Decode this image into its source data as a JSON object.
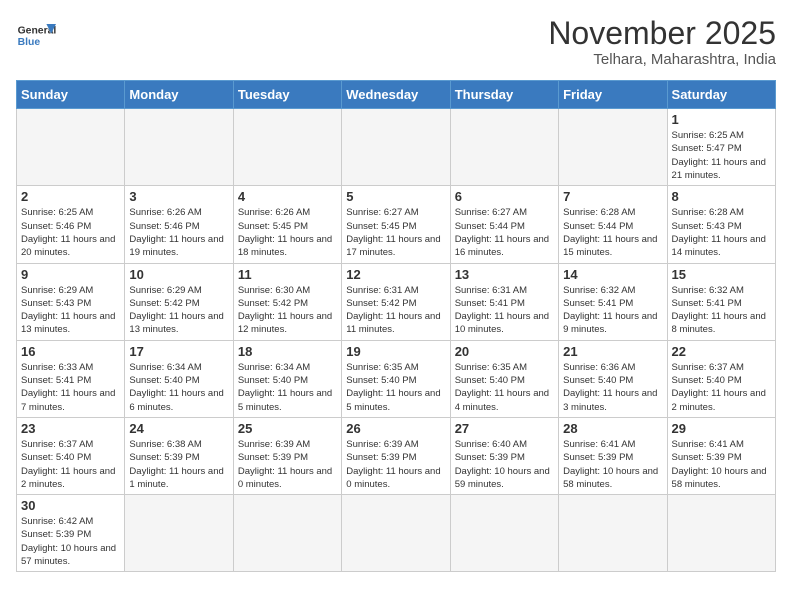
{
  "logo": {
    "text_general": "General",
    "text_blue": "Blue"
  },
  "title": {
    "month_year": "November 2025",
    "location": "Telhara, Maharashtra, India"
  },
  "weekdays": [
    "Sunday",
    "Monday",
    "Tuesday",
    "Wednesday",
    "Thursday",
    "Friday",
    "Saturday"
  ],
  "days": [
    {
      "day": "",
      "info": ""
    },
    {
      "day": "",
      "info": ""
    },
    {
      "day": "",
      "info": ""
    },
    {
      "day": "",
      "info": ""
    },
    {
      "day": "",
      "info": ""
    },
    {
      "day": "",
      "info": ""
    },
    {
      "day": "1",
      "info": "Sunrise: 6:25 AM\nSunset: 5:47 PM\nDaylight: 11 hours and 21 minutes."
    },
    {
      "day": "2",
      "info": "Sunrise: 6:25 AM\nSunset: 5:46 PM\nDaylight: 11 hours and 20 minutes."
    },
    {
      "day": "3",
      "info": "Sunrise: 6:26 AM\nSunset: 5:46 PM\nDaylight: 11 hours and 19 minutes."
    },
    {
      "day": "4",
      "info": "Sunrise: 6:26 AM\nSunset: 5:45 PM\nDaylight: 11 hours and 18 minutes."
    },
    {
      "day": "5",
      "info": "Sunrise: 6:27 AM\nSunset: 5:45 PM\nDaylight: 11 hours and 17 minutes."
    },
    {
      "day": "6",
      "info": "Sunrise: 6:27 AM\nSunset: 5:44 PM\nDaylight: 11 hours and 16 minutes."
    },
    {
      "day": "7",
      "info": "Sunrise: 6:28 AM\nSunset: 5:44 PM\nDaylight: 11 hours and 15 minutes."
    },
    {
      "day": "8",
      "info": "Sunrise: 6:28 AM\nSunset: 5:43 PM\nDaylight: 11 hours and 14 minutes."
    },
    {
      "day": "9",
      "info": "Sunrise: 6:29 AM\nSunset: 5:43 PM\nDaylight: 11 hours and 13 minutes."
    },
    {
      "day": "10",
      "info": "Sunrise: 6:29 AM\nSunset: 5:42 PM\nDaylight: 11 hours and 13 minutes."
    },
    {
      "day": "11",
      "info": "Sunrise: 6:30 AM\nSunset: 5:42 PM\nDaylight: 11 hours and 12 minutes."
    },
    {
      "day": "12",
      "info": "Sunrise: 6:31 AM\nSunset: 5:42 PM\nDaylight: 11 hours and 11 minutes."
    },
    {
      "day": "13",
      "info": "Sunrise: 6:31 AM\nSunset: 5:41 PM\nDaylight: 11 hours and 10 minutes."
    },
    {
      "day": "14",
      "info": "Sunrise: 6:32 AM\nSunset: 5:41 PM\nDaylight: 11 hours and 9 minutes."
    },
    {
      "day": "15",
      "info": "Sunrise: 6:32 AM\nSunset: 5:41 PM\nDaylight: 11 hours and 8 minutes."
    },
    {
      "day": "16",
      "info": "Sunrise: 6:33 AM\nSunset: 5:41 PM\nDaylight: 11 hours and 7 minutes."
    },
    {
      "day": "17",
      "info": "Sunrise: 6:34 AM\nSunset: 5:40 PM\nDaylight: 11 hours and 6 minutes."
    },
    {
      "day": "18",
      "info": "Sunrise: 6:34 AM\nSunset: 5:40 PM\nDaylight: 11 hours and 5 minutes."
    },
    {
      "day": "19",
      "info": "Sunrise: 6:35 AM\nSunset: 5:40 PM\nDaylight: 11 hours and 5 minutes."
    },
    {
      "day": "20",
      "info": "Sunrise: 6:35 AM\nSunset: 5:40 PM\nDaylight: 11 hours and 4 minutes."
    },
    {
      "day": "21",
      "info": "Sunrise: 6:36 AM\nSunset: 5:40 PM\nDaylight: 11 hours and 3 minutes."
    },
    {
      "day": "22",
      "info": "Sunrise: 6:37 AM\nSunset: 5:40 PM\nDaylight: 11 hours and 2 minutes."
    },
    {
      "day": "23",
      "info": "Sunrise: 6:37 AM\nSunset: 5:40 PM\nDaylight: 11 hours and 2 minutes."
    },
    {
      "day": "24",
      "info": "Sunrise: 6:38 AM\nSunset: 5:39 PM\nDaylight: 11 hours and 1 minute."
    },
    {
      "day": "25",
      "info": "Sunrise: 6:39 AM\nSunset: 5:39 PM\nDaylight: 11 hours and 0 minutes."
    },
    {
      "day": "26",
      "info": "Sunrise: 6:39 AM\nSunset: 5:39 PM\nDaylight: 11 hours and 0 minutes."
    },
    {
      "day": "27",
      "info": "Sunrise: 6:40 AM\nSunset: 5:39 PM\nDaylight: 10 hours and 59 minutes."
    },
    {
      "day": "28",
      "info": "Sunrise: 6:41 AM\nSunset: 5:39 PM\nDaylight: 10 hours and 58 minutes."
    },
    {
      "day": "29",
      "info": "Sunrise: 6:41 AM\nSunset: 5:39 PM\nDaylight: 10 hours and 58 minutes."
    },
    {
      "day": "30",
      "info": "Sunrise: 6:42 AM\nSunset: 5:39 PM\nDaylight: 10 hours and 57 minutes."
    },
    {
      "day": "",
      "info": ""
    },
    {
      "day": "",
      "info": ""
    },
    {
      "day": "",
      "info": ""
    },
    {
      "day": "",
      "info": ""
    },
    {
      "day": "",
      "info": ""
    },
    {
      "day": "",
      "info": ""
    }
  ]
}
